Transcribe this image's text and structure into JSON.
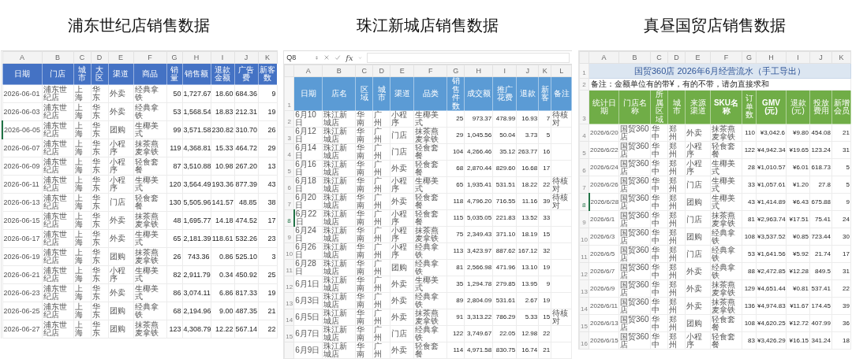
{
  "panels": [
    {
      "kind": "sheet",
      "title": "浦东世纪店销售数据",
      "columns": [
        {
          "letter": "A",
          "header": "日期"
        },
        {
          "letter": "B",
          "header": "门店"
        },
        {
          "letter": "C",
          "header": "城市"
        },
        {
          "letter": "D",
          "header": "大区"
        },
        {
          "letter": "E",
          "header": "渠道"
        },
        {
          "letter": "F",
          "header": "商品"
        },
        {
          "letter": "G",
          "header": "销量"
        },
        {
          "letter": "H",
          "header": "销售额"
        },
        {
          "letter": "I",
          "header": "退款金额"
        },
        {
          "letter": "J",
          "header": "广告费"
        },
        {
          "letter": "K",
          "header": "新客数"
        }
      ],
      "rows": [
        {
          "selected": false,
          "cells": [
            "2026-06-01",
            "浦东世纪店",
            "上海",
            "华东",
            "外卖",
            "经典拿铁",
            "50",
            "1,727.67",
            "18.60",
            "684.36",
            "9"
          ]
        },
        {
          "selected": false,
          "cells": [
            "2026-06-03",
            "浦东世纪店",
            "上海",
            "华东",
            "外卖",
            "经典拿铁",
            "53",
            "1,568.54",
            "18.83",
            "212.31",
            "19"
          ]
        },
        {
          "selected": true,
          "cells": [
            "2026-06-05",
            "浦东世纪店",
            "上海",
            "华东",
            "团购",
            "生椰美式",
            "99",
            "3,571.58",
            "230.82",
            "310.70",
            "26"
          ]
        },
        {
          "selected": false,
          "cells": [
            "2026-06-07",
            "浦东世纪店",
            "上海",
            "华东",
            "小程序",
            "抹茶燕麦拿铁",
            "119",
            "4,368.81",
            "15.33",
            "464.72",
            "29"
          ]
        },
        {
          "selected": false,
          "cells": [
            "2026-06-09",
            "浦东世纪店",
            "上海",
            "华东",
            "小程序",
            "轻食套餐",
            "87",
            "3,510.88",
            "10.98",
            "267.20",
            "13"
          ]
        },
        {
          "selected": false,
          "cells": [
            "2026-06-11",
            "浦东世纪店",
            "上海",
            "华东",
            "小程序",
            "生椰美式",
            "120",
            "3,564.49",
            "193.36",
            "877.39",
            "43"
          ]
        },
        {
          "selected": false,
          "cells": [
            "2026-06-13",
            "浦东世纪店",
            "上海",
            "华东",
            "门店",
            "轻食套餐",
            "130",
            "5,505.96",
            "141.57",
            "48.85",
            "38"
          ]
        },
        {
          "selected": false,
          "cells": [
            "2026-06-15",
            "浦东世纪店",
            "上海",
            "华东",
            "外卖",
            "抹茶燕麦拿铁",
            "48",
            "1,695.77",
            "14.18",
            "474.52",
            "17"
          ]
        },
        {
          "selected": false,
          "cells": [
            "2026-06-17",
            "浦东世纪店",
            "上海",
            "华东",
            "外卖",
            "生椰美式",
            "65",
            "2,181.39",
            "118.61",
            "532.26",
            "23"
          ]
        },
        {
          "selected": false,
          "cells": [
            "2026-06-19",
            "浦东世纪店",
            "上海",
            "华东",
            "团购",
            "抹茶燕麦拿铁",
            "26",
            "743.36",
            "0.86",
            "525.10",
            "3"
          ]
        },
        {
          "selected": false,
          "cells": [
            "2026-06-21",
            "浦东世纪店",
            "上海",
            "华东",
            "小程序",
            "生椰美式",
            "82",
            "2,911.79",
            "0.34",
            "450.92",
            "25"
          ]
        },
        {
          "selected": false,
          "cells": [
            "2026-06-23",
            "浦东世纪店",
            "上海",
            "华东",
            "外卖",
            "生椰美式",
            "86",
            "3,074.11",
            "6.86",
            "817.33",
            "19"
          ]
        },
        {
          "selected": false,
          "cells": [
            "2026-06-25",
            "浦东世纪店",
            "上海",
            "华东",
            "团购",
            "经典拿铁",
            "68",
            "2,194.96",
            "9.00",
            "487.35",
            "21"
          ]
        },
        {
          "selected": false,
          "cells": [
            "2026-06-27",
            "浦东世纪店",
            "上海",
            "华东",
            "团购",
            "抹茶燕麦拿铁",
            "123",
            "4,308.79",
            "12.22",
            "567.14",
            "22"
          ]
        }
      ]
    },
    {
      "kind": "formula_sheet",
      "title": "珠江新城店销售数据",
      "formula_bar": {
        "cell_ref": "Q8",
        "fx": "fx"
      },
      "header_row_number": "1",
      "columns": [
        {
          "letter": "A",
          "header": "日期"
        },
        {
          "letter": "B",
          "header": "店名"
        },
        {
          "letter": "C",
          "header": "区域"
        },
        {
          "letter": "D",
          "header": "城市"
        },
        {
          "letter": "E",
          "header": "渠道"
        },
        {
          "letter": "F",
          "header": "品类"
        },
        {
          "letter": "G",
          "header": "销售件数"
        },
        {
          "letter": "H",
          "header": "成交额"
        },
        {
          "letter": "I",
          "header": "推广花费"
        },
        {
          "letter": "J",
          "header": "退款"
        },
        {
          "letter": "K",
          "header": "新客"
        },
        {
          "letter": "L",
          "header": "备注"
        }
      ],
      "rows": [
        {
          "number": "2",
          "selected": false,
          "cells": [
            "6月10日",
            "珠江新城店",
            "华南",
            "广州",
            "小程序",
            "生椰美式",
            "25",
            "973.37",
            "478.99",
            "16.93",
            "7",
            "待核对"
          ]
        },
        {
          "number": "3",
          "selected": false,
          "cells": [
            "6月12日",
            "珠江新城店",
            "华南",
            "广州",
            "门店",
            "抹茶燕麦拿铁",
            "29",
            "1,045.56",
            "50.04",
            "3.73",
            "5"
          ]
        },
        {
          "number": "4",
          "selected": false,
          "cells": [
            "6月14日",
            "珠江新城店",
            "华南",
            "广州",
            "门店",
            "轻食套餐",
            "104",
            "4,266.46",
            "35.12",
            "263.77",
            "16"
          ]
        },
        {
          "number": "5",
          "selected": false,
          "cells": [
            "6月16日",
            "珠江新城店",
            "华南",
            "广州",
            "外卖",
            "轻食套餐",
            "68",
            "2,870.44",
            "829.60",
            "16.68",
            "17"
          ]
        },
        {
          "number": "6",
          "selected": false,
          "cells": [
            "6月18日",
            "珠江新城店",
            "华南",
            "广州",
            "小程序",
            "生椰美式",
            "65",
            "1,935.41",
            "531.51",
            "18.22",
            "22",
            "待核对"
          ]
        },
        {
          "number": "7",
          "selected": false,
          "cells": [
            "6月20日",
            "珠江新城店",
            "华南",
            "广州",
            "外卖",
            "轻食套餐",
            "118",
            "4,796.20",
            "716.55",
            "11.16",
            "39",
            "待核对"
          ]
        },
        {
          "number": "8",
          "selected": true,
          "cells": [
            "6月22日",
            "珠江新城店",
            "华南",
            "广州",
            "小程序",
            "轻食套餐",
            "115",
            "5,035.05",
            "221.83",
            "13.52",
            "33"
          ]
        },
        {
          "number": "9",
          "selected": false,
          "cells": [
            "6月24日",
            "珠江新城店",
            "华南",
            "广州",
            "小程序",
            "抹茶燕麦拿铁",
            "75",
            "2,349.43",
            "371.10",
            "18.19",
            "15"
          ]
        },
        {
          "number": "10",
          "selected": false,
          "cells": [
            "6月26日",
            "珠江新城店",
            "华南",
            "广州",
            "小程序",
            "经典拿铁",
            "113",
            "3,423.97",
            "887.62",
            "167.12",
            "32"
          ]
        },
        {
          "number": "11",
          "selected": false,
          "cells": [
            "6月28日",
            "珠江新城店",
            "华南",
            "广州",
            "团购",
            "经典拿铁",
            "81",
            "2,566.98",
            "471.96",
            "13.10",
            "19"
          ]
        },
        {
          "number": "12",
          "selected": false,
          "cells": [
            "6月1日",
            "珠江新城店",
            "华南",
            "广州",
            "外卖",
            "生椰美式",
            "35",
            "1,294.78",
            "279.85",
            "13.95",
            "9"
          ]
        },
        {
          "number": "13",
          "selected": false,
          "cells": [
            "6月3日",
            "珠江新城店",
            "华南",
            "广州",
            "外卖",
            "经典拿铁",
            "89",
            "2,804.09",
            "531.61",
            "2.67",
            "19"
          ]
        },
        {
          "number": "14",
          "selected": false,
          "cells": [
            "6月5日",
            "珠江新城店",
            "华南",
            "广州",
            "外卖",
            "抹茶燕麦拿铁",
            "91",
            "3,313.22",
            "786.29",
            "5.33",
            "15",
            "待核对"
          ]
        },
        {
          "number": "15",
          "selected": false,
          "cells": [
            "6月7日",
            "珠江新城店",
            "华南",
            "广州",
            "门店",
            "经典拿铁",
            "122",
            "3,749.67",
            "22.05",
            "12.98",
            "22"
          ]
        },
        {
          "selected": false,
          "cells": [
            "6月9日",
            "珠江新城店",
            "华南",
            "广州",
            "外卖",
            "轻食套餐",
            "114",
            "4,971.58",
            "830.75",
            "16.74",
            "21"
          ]
        }
      ]
    },
    {
      "kind": "report_sheet",
      "title": "真昼国贸店销售数据",
      "banner_row_number": "1",
      "banner": "国贸360店 2026年6月经营流水（手工导出）",
      "note_row_number": "2",
      "note": "备注：金额单位有的带¥，有的不带，请勿直接求和",
      "header_row_number": "3",
      "columns": [
        {
          "letter": "A",
          "header": "统计日期"
        },
        {
          "letter": "B",
          "header": "门店名称"
        },
        {
          "letter": "C",
          "header": "所属区域"
        },
        {
          "letter": "D",
          "header": "城市"
        },
        {
          "letter": "E",
          "header": "来源渠道"
        },
        {
          "letter": "F",
          "header": "SKU名称"
        },
        {
          "letter": "G",
          "header": "订单数"
        },
        {
          "letter": "H",
          "header": "GMV(元)"
        },
        {
          "letter": "I",
          "header": "退款(元)"
        },
        {
          "letter": "J",
          "header": "投放费用"
        },
        {
          "letter": "K",
          "header": "新增会员"
        }
      ],
      "rows": [
        {
          "number": "4",
          "selected": false,
          "cells": [
            "2026/6/20",
            "国贸360店",
            "华中",
            "郑州",
            "外卖",
            "抹茶燕麦拿铁",
            "110",
            "¥3,042.6",
            "¥9.80",
            "454.08",
            "21"
          ]
        },
        {
          "number": "5",
          "selected": false,
          "cells": [
            "2026/6/22",
            "国贸360店",
            "华中",
            "郑州",
            "小程序",
            "轻食套餐",
            "122",
            "¥4,942.34",
            "¥19.65",
            "123.24",
            "31"
          ]
        },
        {
          "number": "6",
          "selected": false,
          "cells": [
            "2026/6/24",
            "国贸360店",
            "华中",
            "郑州",
            "小程序",
            "生椰美式",
            "28",
            "¥1,010.57",
            "¥6.01",
            "618.73",
            "5"
          ]
        },
        {
          "number": "7",
          "selected": false,
          "cells": [
            "2026/6/26",
            "国贸360店",
            "华中",
            "郑州",
            "门店",
            "生椰美式",
            "33",
            "¥1,057.61",
            "¥1.20",
            "27.8",
            "5"
          ]
        },
        {
          "number": "8",
          "selected": true,
          "cells": [
            "2026/6/28",
            "国贸360店",
            "华中",
            "郑州",
            "团购",
            "生椰美式",
            "43",
            "¥1,414.89",
            "¥6.43",
            "675.88",
            "9"
          ]
        },
        {
          "number": "9",
          "selected": false,
          "cells": [
            "2026/6/1",
            "国贸360店",
            "华中",
            "郑州",
            "门店",
            "抹茶燕麦拿铁",
            "81",
            "¥2,963.74",
            "¥17.51",
            "75.41",
            "24"
          ]
        },
        {
          "number": "10",
          "selected": false,
          "cells": [
            "2026/6/3",
            "国贸360店",
            "华中",
            "郑州",
            "团购",
            "经典拿铁",
            "108",
            "¥3,537.52",
            "¥0.85",
            "723.44",
            "30"
          ]
        },
        {
          "number": "11",
          "selected": false,
          "cells": [
            "2026/6/5",
            "国贸360店",
            "华中",
            "郑州",
            "门店",
            "经典拿铁",
            "53",
            "¥1,641.56",
            "¥5.92",
            "21.74",
            "17"
          ]
        },
        {
          "number": "12",
          "selected": false,
          "cells": [
            "2026/6/7",
            "国贸360店",
            "华中",
            "郑州",
            "外卖",
            "经典拿铁",
            "88",
            "¥2,472.85",
            "¥12.28",
            "849.5",
            "31"
          ]
        },
        {
          "number": "13",
          "selected": false,
          "cells": [
            "2026/6/9",
            "国贸360店",
            "华中",
            "郑州",
            "外卖",
            "抹茶燕麦拿铁",
            "129",
            "¥4,651.44",
            "¥0.81",
            "537.41",
            "22"
          ]
        },
        {
          "number": "14",
          "selected": false,
          "cells": [
            "2026/6/11",
            "国贸360店",
            "华中",
            "郑州",
            "外卖",
            "抹茶燕麦拿铁",
            "136",
            "¥4,974.83",
            "¥11.67",
            "174.45",
            "39"
          ]
        },
        {
          "number": "15",
          "selected": false,
          "cells": [
            "2026/6/13",
            "国贸360店",
            "华中",
            "郑州",
            "团购",
            "轻食套餐",
            "108",
            "¥4,620.25",
            "¥12.72",
            "407.99",
            "36"
          ]
        },
        {
          "number": "16",
          "selected": false,
          "cells": [
            "2026/6/15",
            "国贸360店",
            "华中",
            "郑州",
            "小程序",
            "轻食套餐",
            "83",
            "¥3,426.29",
            "¥16.15",
            "341.24",
            "18"
          ]
        }
      ]
    }
  ]
}
